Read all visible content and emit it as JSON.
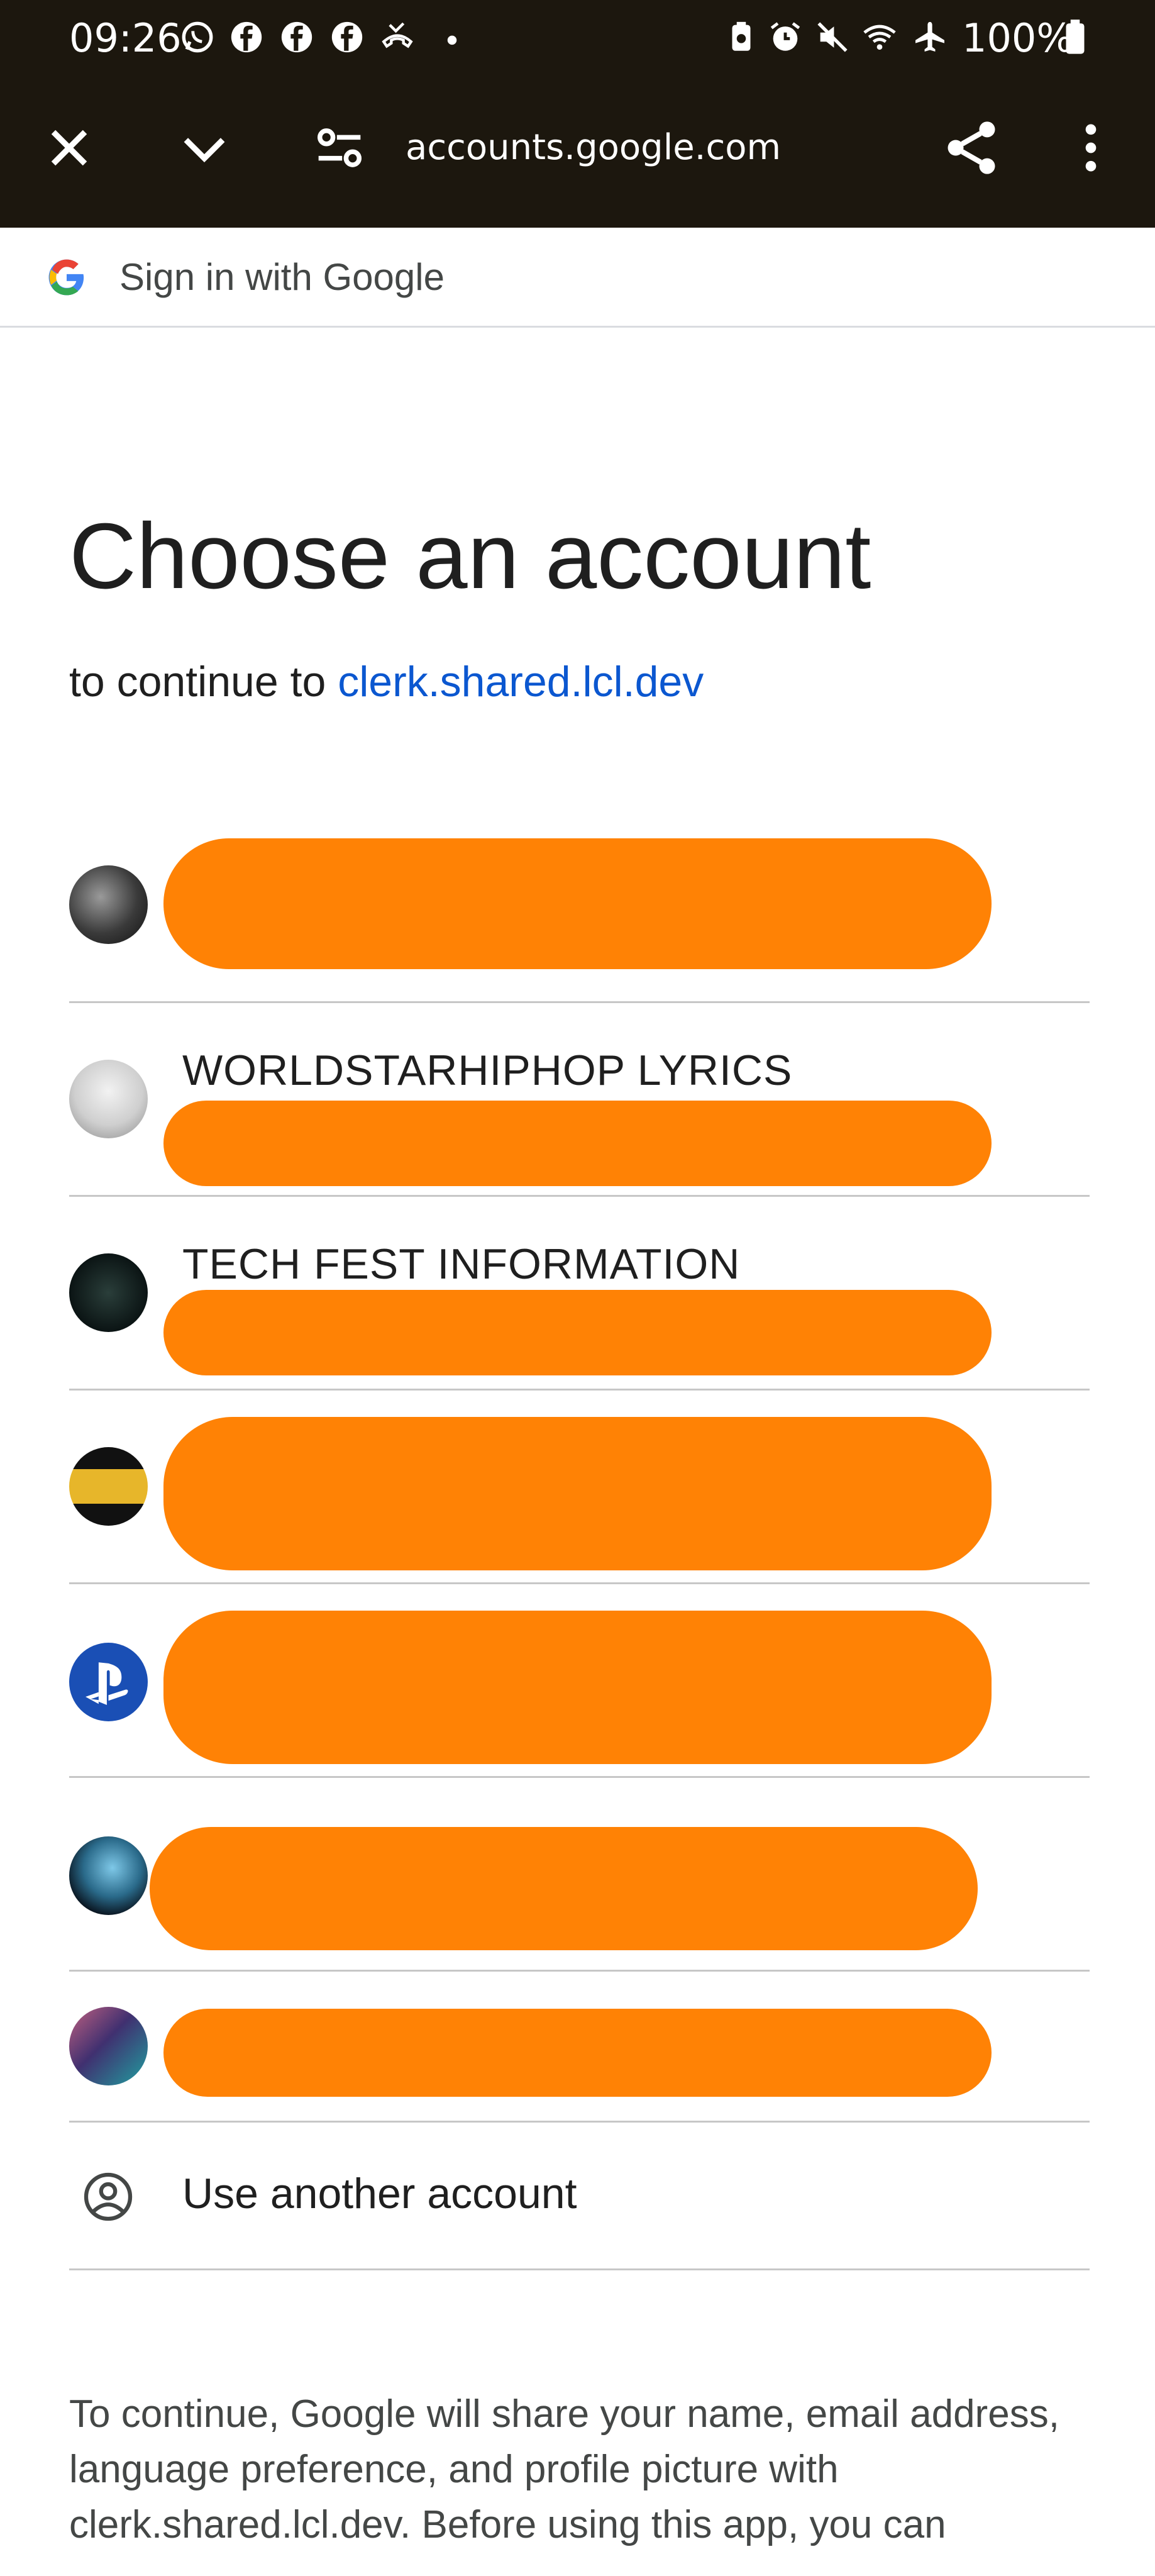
{
  "status_bar": {
    "time": "09:26",
    "battery": "100%",
    "left_icons": [
      "whatsapp-icon",
      "facebook-icon",
      "facebook-icon",
      "facebook-icon",
      "missed-call-icon",
      "dot-icon"
    ],
    "right_icons": [
      "battery-saver-icon",
      "alarm-icon",
      "mute-icon",
      "wifi-calling-icon",
      "airplane-icon",
      "battery-icon"
    ]
  },
  "browser": {
    "url": "accounts.google.com",
    "close_icon": "close-icon",
    "collapse_icon": "chevron-down-icon",
    "site_settings_icon": "tune-icon",
    "share_icon": "share-icon",
    "menu_icon": "more-vert-icon"
  },
  "signin_header": {
    "title": "Sign in with Google"
  },
  "page": {
    "heading": "Choose an account",
    "subtitle_prefix": "to continue to ",
    "subtitle_link": "clerk.shared.lcl.dev"
  },
  "accounts": [
    {
      "name": "",
      "redacted": true
    },
    {
      "name": "WORLDSTARHIPHOP LYRICS",
      "redacted": true
    },
    {
      "name": "TECH FEST INFORMATION",
      "redacted": true
    },
    {
      "name": "",
      "redacted": true
    },
    {
      "name": "",
      "redacted": true
    },
    {
      "name": "",
      "redacted": true
    },
    {
      "name": "",
      "redacted": true
    }
  ],
  "use_another": {
    "label": "Use another account",
    "icon": "account-circle-icon"
  },
  "footer": {
    "text": "To continue, Google will share your name, email address, language preference, and profile picture with clerk.shared.lcl.dev. Before using this app, you can"
  },
  "colors": {
    "topbar": "#1c170e",
    "link": "#0b57d0",
    "redaction": "#ff8205",
    "divider": "#c7c7c7"
  }
}
